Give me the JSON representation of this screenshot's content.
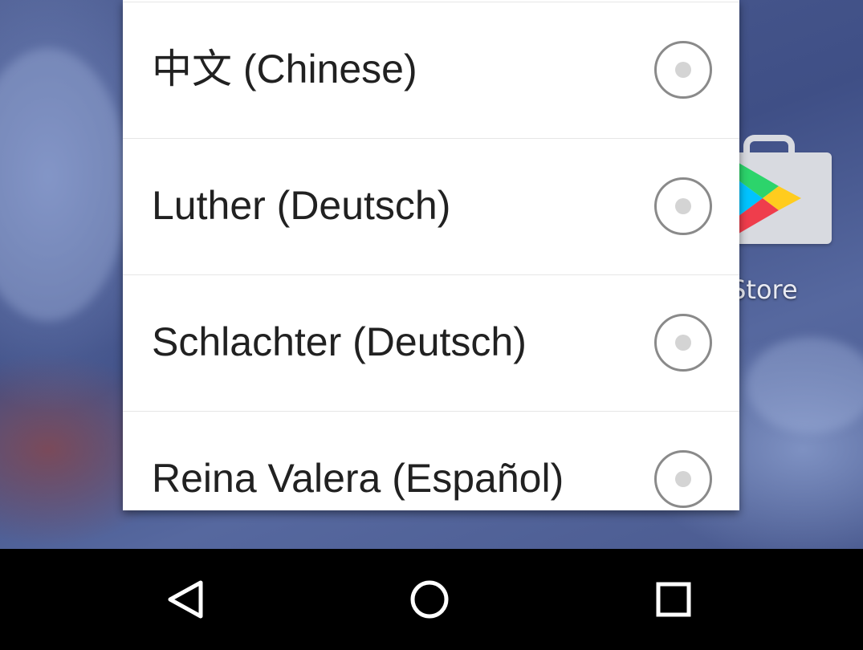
{
  "background_app": {
    "label": "Play Store",
    "visible_label": "y Store",
    "icon": "play-store-icon"
  },
  "dialog": {
    "options": [
      {
        "label": "中文 (Chinese)",
        "selected": false
      },
      {
        "label": "Luther (Deutsch)",
        "selected": false
      },
      {
        "label": "Schlachter (Deutsch)",
        "selected": false
      },
      {
        "label": "Reina Valera (Español)",
        "selected": false
      }
    ]
  },
  "navbar": {
    "buttons": [
      {
        "name": "back",
        "icon": "back-triangle-icon"
      },
      {
        "name": "home",
        "icon": "home-circle-icon"
      },
      {
        "name": "recents",
        "icon": "recents-square-icon"
      }
    ]
  },
  "colors": {
    "dialog_bg": "#ffffff",
    "divider": "#e6e6e6",
    "text": "#212121",
    "radio_ring": "#8a8a8a",
    "navbar_bg": "#000000",
    "nav_icon": "#ffffff"
  }
}
